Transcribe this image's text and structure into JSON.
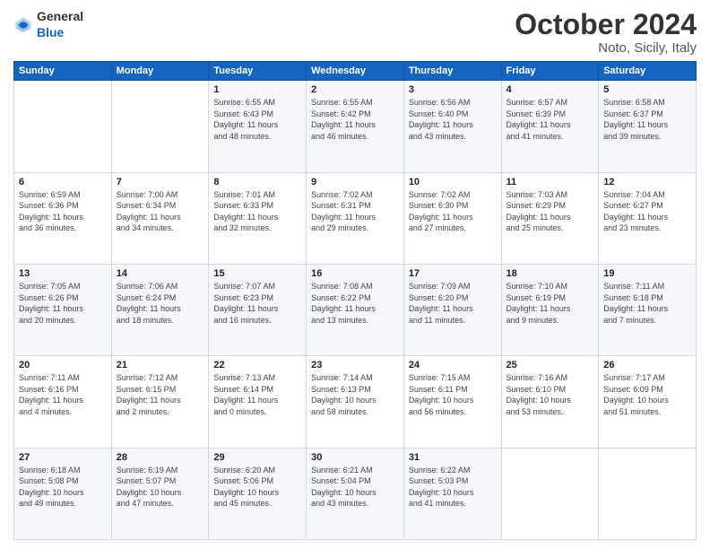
{
  "header": {
    "logo_general": "General",
    "logo_blue": "Blue",
    "title": "October 2024",
    "location": "Noto, Sicily, Italy"
  },
  "columns": [
    "Sunday",
    "Monday",
    "Tuesday",
    "Wednesday",
    "Thursday",
    "Friday",
    "Saturday"
  ],
  "weeks": [
    [
      {
        "day": "",
        "info": ""
      },
      {
        "day": "",
        "info": ""
      },
      {
        "day": "1",
        "info": "Sunrise: 6:55 AM\nSunset: 6:43 PM\nDaylight: 11 hours\nand 48 minutes."
      },
      {
        "day": "2",
        "info": "Sunrise: 6:55 AM\nSunset: 6:42 PM\nDaylight: 11 hours\nand 46 minutes."
      },
      {
        "day": "3",
        "info": "Sunrise: 6:56 AM\nSunset: 6:40 PM\nDaylight: 11 hours\nand 43 minutes."
      },
      {
        "day": "4",
        "info": "Sunrise: 6:57 AM\nSunset: 6:39 PM\nDaylight: 11 hours\nand 41 minutes."
      },
      {
        "day": "5",
        "info": "Sunrise: 6:58 AM\nSunset: 6:37 PM\nDaylight: 11 hours\nand 39 minutes."
      }
    ],
    [
      {
        "day": "6",
        "info": "Sunrise: 6:59 AM\nSunset: 6:36 PM\nDaylight: 11 hours\nand 36 minutes."
      },
      {
        "day": "7",
        "info": "Sunrise: 7:00 AM\nSunset: 6:34 PM\nDaylight: 11 hours\nand 34 minutes."
      },
      {
        "day": "8",
        "info": "Sunrise: 7:01 AM\nSunset: 6:33 PM\nDaylight: 11 hours\nand 32 minutes."
      },
      {
        "day": "9",
        "info": "Sunrise: 7:02 AM\nSunset: 6:31 PM\nDaylight: 11 hours\nand 29 minutes."
      },
      {
        "day": "10",
        "info": "Sunrise: 7:02 AM\nSunset: 6:30 PM\nDaylight: 11 hours\nand 27 minutes."
      },
      {
        "day": "11",
        "info": "Sunrise: 7:03 AM\nSunset: 6:29 PM\nDaylight: 11 hours\nand 25 minutes."
      },
      {
        "day": "12",
        "info": "Sunrise: 7:04 AM\nSunset: 6:27 PM\nDaylight: 11 hours\nand 23 minutes."
      }
    ],
    [
      {
        "day": "13",
        "info": "Sunrise: 7:05 AM\nSunset: 6:26 PM\nDaylight: 11 hours\nand 20 minutes."
      },
      {
        "day": "14",
        "info": "Sunrise: 7:06 AM\nSunset: 6:24 PM\nDaylight: 11 hours\nand 18 minutes."
      },
      {
        "day": "15",
        "info": "Sunrise: 7:07 AM\nSunset: 6:23 PM\nDaylight: 11 hours\nand 16 minutes."
      },
      {
        "day": "16",
        "info": "Sunrise: 7:08 AM\nSunset: 6:22 PM\nDaylight: 11 hours\nand 13 minutes."
      },
      {
        "day": "17",
        "info": "Sunrise: 7:09 AM\nSunset: 6:20 PM\nDaylight: 11 hours\nand 11 minutes."
      },
      {
        "day": "18",
        "info": "Sunrise: 7:10 AM\nSunset: 6:19 PM\nDaylight: 11 hours\nand 9 minutes."
      },
      {
        "day": "19",
        "info": "Sunrise: 7:11 AM\nSunset: 6:18 PM\nDaylight: 11 hours\nand 7 minutes."
      }
    ],
    [
      {
        "day": "20",
        "info": "Sunrise: 7:11 AM\nSunset: 6:16 PM\nDaylight: 11 hours\nand 4 minutes."
      },
      {
        "day": "21",
        "info": "Sunrise: 7:12 AM\nSunset: 6:15 PM\nDaylight: 11 hours\nand 2 minutes."
      },
      {
        "day": "22",
        "info": "Sunrise: 7:13 AM\nSunset: 6:14 PM\nDaylight: 11 hours\nand 0 minutes."
      },
      {
        "day": "23",
        "info": "Sunrise: 7:14 AM\nSunset: 6:13 PM\nDaylight: 10 hours\nand 58 minutes."
      },
      {
        "day": "24",
        "info": "Sunrise: 7:15 AM\nSunset: 6:11 PM\nDaylight: 10 hours\nand 56 minutes."
      },
      {
        "day": "25",
        "info": "Sunrise: 7:16 AM\nSunset: 6:10 PM\nDaylight: 10 hours\nand 53 minutes."
      },
      {
        "day": "26",
        "info": "Sunrise: 7:17 AM\nSunset: 6:09 PM\nDaylight: 10 hours\nand 51 minutes."
      }
    ],
    [
      {
        "day": "27",
        "info": "Sunrise: 6:18 AM\nSunset: 5:08 PM\nDaylight: 10 hours\nand 49 minutes."
      },
      {
        "day": "28",
        "info": "Sunrise: 6:19 AM\nSunset: 5:07 PM\nDaylight: 10 hours\nand 47 minutes."
      },
      {
        "day": "29",
        "info": "Sunrise: 6:20 AM\nSunset: 5:06 PM\nDaylight: 10 hours\nand 45 minutes."
      },
      {
        "day": "30",
        "info": "Sunrise: 6:21 AM\nSunset: 5:04 PM\nDaylight: 10 hours\nand 43 minutes."
      },
      {
        "day": "31",
        "info": "Sunrise: 6:22 AM\nSunset: 5:03 PM\nDaylight: 10 hours\nand 41 minutes."
      },
      {
        "day": "",
        "info": ""
      },
      {
        "day": "",
        "info": ""
      }
    ]
  ]
}
